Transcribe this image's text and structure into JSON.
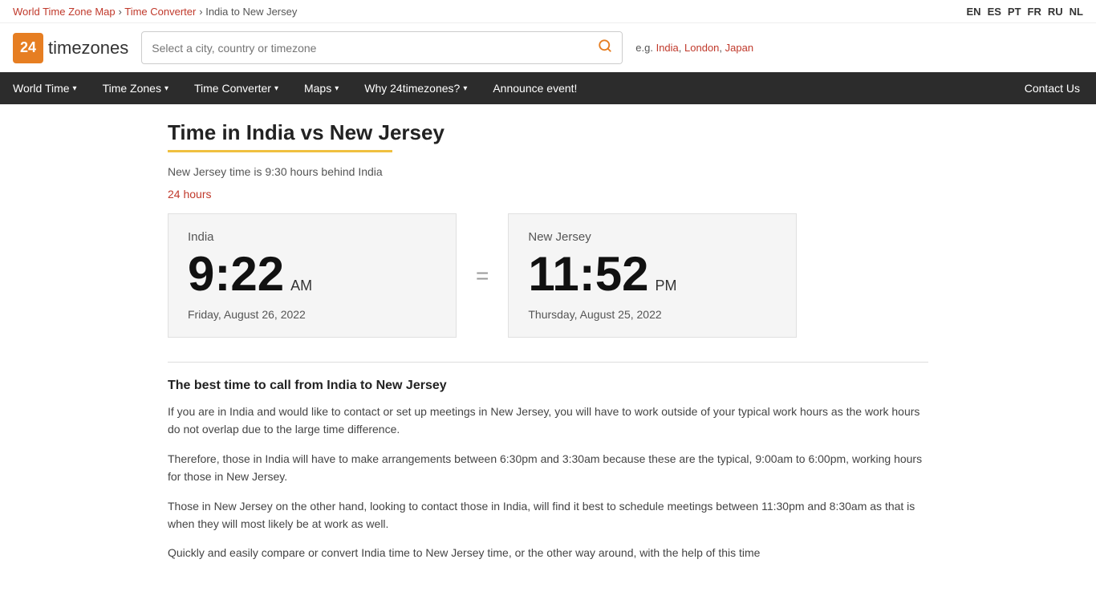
{
  "breadcrumb": {
    "world_time_zone_map": "World Time Zone Map",
    "time_converter": "Time Converter",
    "current": "India to New Jersey",
    "separator": ">"
  },
  "languages": [
    "EN",
    "ES",
    "PT",
    "FR",
    "RU",
    "NL"
  ],
  "header": {
    "logo_number": "24",
    "logo_text": "timezones",
    "search_placeholder": "Select a city, country or timezone",
    "example_label": "e.g.",
    "example_links": [
      "India",
      "London",
      "Japan"
    ]
  },
  "nav": {
    "items": [
      {
        "label": "World Time",
        "has_dropdown": true
      },
      {
        "label": "Time Zones",
        "has_dropdown": true
      },
      {
        "label": "Time Converter",
        "has_dropdown": true
      },
      {
        "label": "Maps",
        "has_dropdown": true
      },
      {
        "label": "Why 24timezones?",
        "has_dropdown": true
      },
      {
        "label": "Announce event!",
        "has_dropdown": false
      }
    ],
    "contact_us": "Contact Us"
  },
  "page": {
    "title": "Time in India vs New Jersey",
    "subtitle": "New Jersey time is 9:30 hours behind India",
    "hours_toggle": "24 hours"
  },
  "india_clock": {
    "location": "India",
    "time": "9:22",
    "ampm": "AM",
    "date": "Friday, August 26, 2022"
  },
  "nj_clock": {
    "location": "New Jersey",
    "time": "11:52",
    "ampm": "PM",
    "date": "Thursday, August 25, 2022"
  },
  "equals": "=",
  "best_time": {
    "heading": "The best time to call from India to New Jersey",
    "paragraph1": "If you are in India and would like to contact or set up meetings in New Jersey, you will have to work outside of your typical work hours as the work hours do not overlap due to the large time difference.",
    "paragraph2": "Therefore, those in India will have to make arrangements between 6:30pm and 3:30am because these are the typical, 9:00am to 6:00pm, working hours for those in New Jersey.",
    "paragraph3": "Those in New Jersey on the other hand, looking to contact those in India, will find it best to schedule meetings between 11:30pm and 8:30am as that is when they will most likely be at work as well.",
    "paragraph4": "Quickly and easily compare or convert India time to New Jersey time, or the other way around, with the help of this time"
  }
}
